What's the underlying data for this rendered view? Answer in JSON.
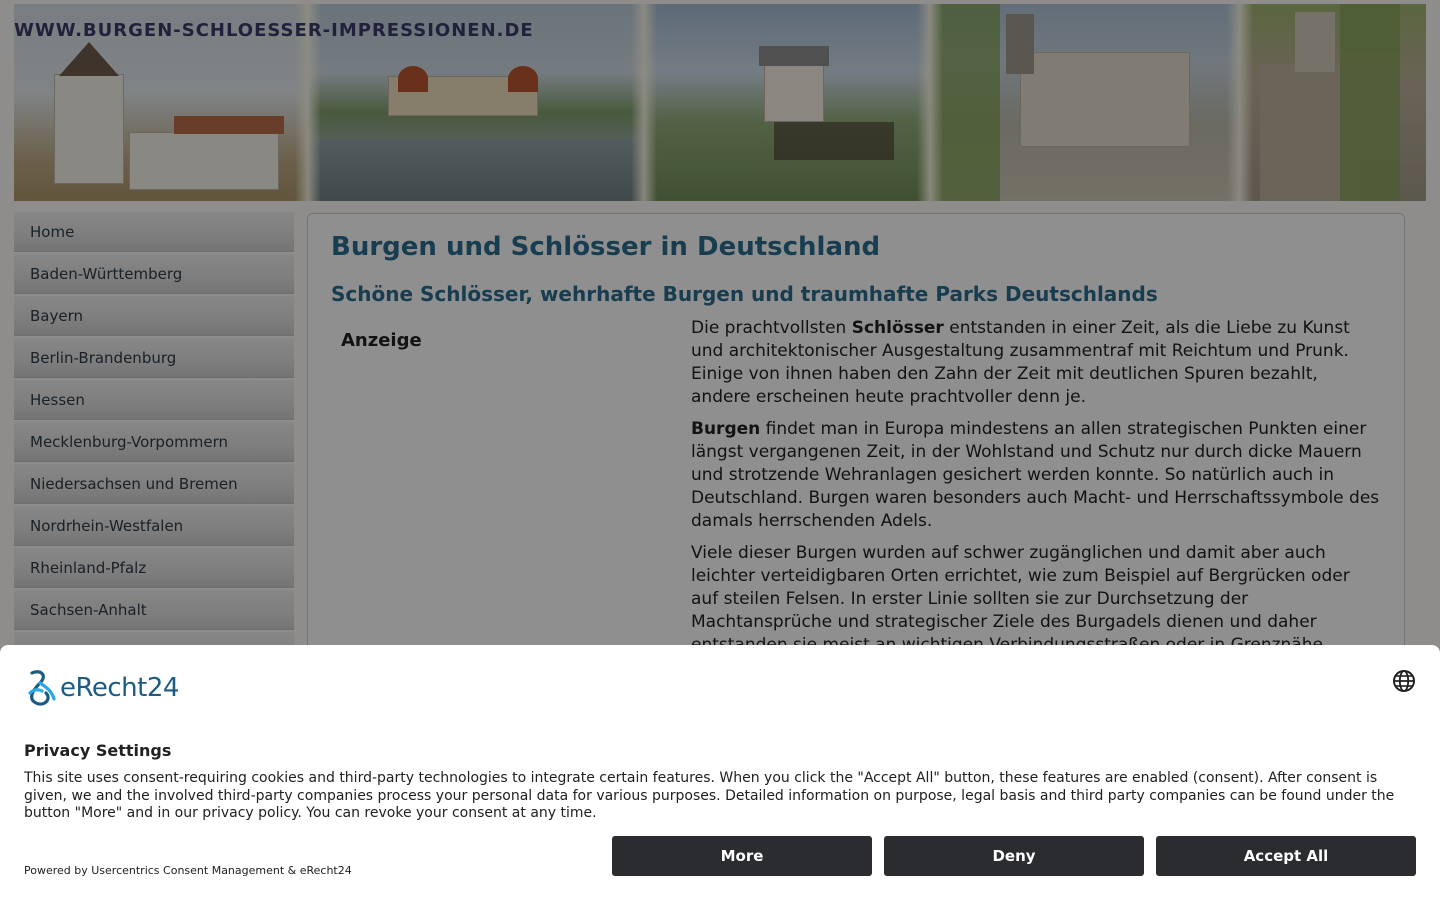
{
  "site": {
    "title": "WWW.BURGEN-SCHLOESSER-IMPRESSIONEN.DE",
    "nav": [
      {
        "label": "Home"
      },
      {
        "label": "Baden-Württemberg"
      },
      {
        "label": "Bayern"
      },
      {
        "label": "Berlin-Brandenburg"
      },
      {
        "label": "Hessen"
      },
      {
        "label": "Mecklenburg-Vorpommern"
      },
      {
        "label": "Niedersachsen und Bremen"
      },
      {
        "label": "Nordrhein-Westfalen"
      },
      {
        "label": "Rheinland-Pfalz"
      },
      {
        "label": "Sachsen-Anhalt"
      }
    ],
    "content": {
      "heading": "Burgen und Schlösser in Deutschland",
      "subheading": "Schöne Schlösser, wehrhafte Burgen und traumhafte Parks Deutschlands",
      "ad_label": "Anzeige",
      "p1_a": "Die prachtvollsten ",
      "p1_b": "Schlösser",
      "p1_c": " entstanden in einer Zeit, als die Liebe zu Kunst und architektonischer Ausgestaltung zusammentraf mit Reichtum und Prunk. Einige von ihnen haben den Zahn der Zeit mit deutlichen Spuren bezahlt, andere erscheinen heute prachtvoller denn je.",
      "p2_a": "Burgen",
      "p2_b": " findet man in Europa mindestens an allen strategischen Punkten einer längst vergangenen Zeit, in der Wohlstand und Schutz nur durch dicke Mauern und strotzende Wehranlagen gesichert werden konnte. So natürlich auch in Deutschland. Burgen waren besonders auch Macht- und Herrschaftssymbole des damals herrschenden Adels.",
      "p3": "Viele dieser Burgen wurden auf schwer zugänglichen und damit aber auch leichter verteidigbaren Orten errichtet, wie zum Beispiel auf Bergrücken oder auf steilen Felsen. In erster Linie sollten sie zur Durchsetzung der Machtansprüche und strategischer Ziele des Burgadels dienen und daher entstanden sie meist an wichtigen Verbindungsstraßen oder in Grenznähe."
    }
  },
  "consent": {
    "brand": "eRecht24",
    "title": "Privacy Settings",
    "text": "This site uses consent-requiring cookies and third-party technologies to integrate certain features. When you click the \"Accept All\" button, these features are enabled (consent). After consent is given, we and the involved third-party companies process your personal data for various purposes. Detailed information on purpose, legal basis and third party companies can be found under the button \"More\" and in our privacy policy. You can revoke your consent at any time.",
    "powered_by": "Powered by Usercentrics Consent Management & eRecht24",
    "buttons": {
      "more": "More",
      "deny": "Deny",
      "accept": "Accept All"
    },
    "icons": {
      "language": "globe-icon"
    },
    "colors": {
      "button_bg": "#2a2c30",
      "brand": "#1c5c84",
      "accent": "#29a9e1"
    }
  }
}
